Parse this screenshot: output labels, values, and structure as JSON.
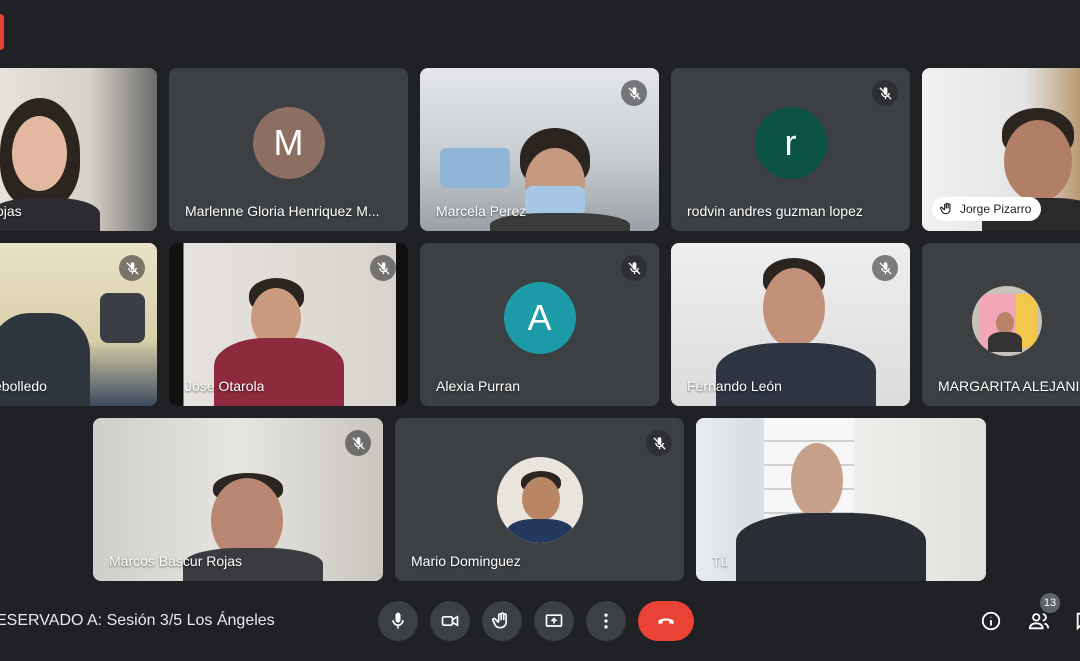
{
  "meeting": {
    "title": "ESERVADO A: Sesión 3/5 Los Ángeles"
  },
  "participants": [
    {
      "name": "ojas"
    },
    {
      "name": "Marlenne Gloria Henriquez M...",
      "initial": "M",
      "color": "#8d6e63"
    },
    {
      "name": "Marcela Perez"
    },
    {
      "name": "rodvin andres guzman lopez",
      "initial": "r",
      "color": "#0b5345"
    },
    {
      "name": "Jorge Pizarro",
      "hand_raised": true
    },
    {
      "name": "ebolledo"
    },
    {
      "name": "Jose Otarola"
    },
    {
      "name": "Alexia Purran",
      "initial": "A",
      "color": "#1e9ba8"
    },
    {
      "name": "Fernando León"
    },
    {
      "name": "MARGARITA ALEJANI"
    },
    {
      "name": "Marcos Bascur Rojas"
    },
    {
      "name": "Mario Dominguez"
    },
    {
      "name": "Tú"
    }
  ],
  "participants_count": "13",
  "colors": {
    "end_call": "#ea4335",
    "active_speaker_border": "#8ab4f8",
    "background": "#202124"
  }
}
